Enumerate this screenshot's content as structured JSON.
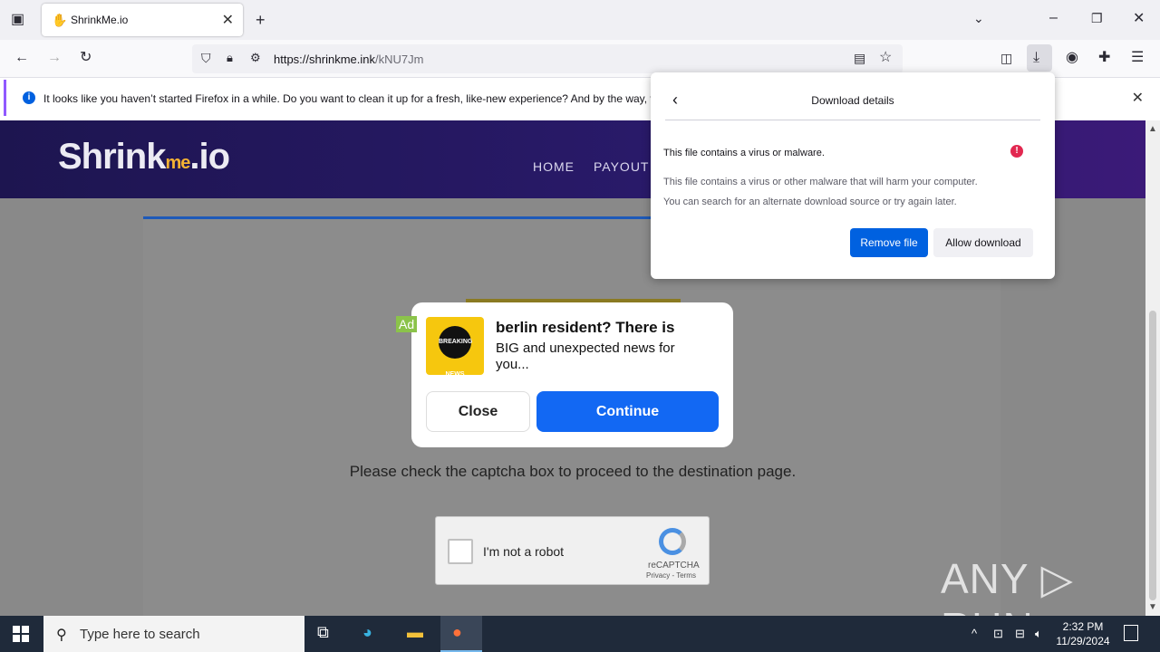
{
  "browser": {
    "tab_title": "ShrinkMe.io",
    "url_host": "https://shrinkme.ink",
    "url_path": "/kNU7Jm",
    "notification": "It looks like you haven’t started Firefox in a while. Do you want to clean it up for a fresh, like-new experience? And by the way, w"
  },
  "site": {
    "logo_main": "Shrink",
    "logo_me": "me",
    "logo_tld": ".io",
    "nav": [
      "HOME",
      "PAYOUT"
    ],
    "captcha_message": "Please check the captcha box to proceed to the destination page.",
    "recaptcha": {
      "label": "I'm not a robot",
      "brand": "reCAPTCHA",
      "links": "Privacy - Terms"
    }
  },
  "ad": {
    "tag": "Ad",
    "image_text": "BREAKING NEWS",
    "title": "berlin resident? There is",
    "body": "BIG and unexpected news for you...",
    "close_label": "Close",
    "continue_label": "Continue"
  },
  "download_panel": {
    "title": "Download details",
    "heading": "This file contains a virus or malware.",
    "line1": "This file contains a virus or other malware that will harm your computer.",
    "line2": "You can search for an alternate download source or try again later.",
    "remove_label": "Remove file",
    "allow_label": "Allow download"
  },
  "watermark": "ANY ▷ RUN",
  "taskbar": {
    "search_placeholder": "Type here to search",
    "time": "2:32 PM",
    "date": "11/29/2024"
  },
  "colors": {
    "accent": "#0061e0",
    "danger": "#e22850",
    "ad_continue": "#1268f3",
    "site_header": "#2a1a6b"
  }
}
